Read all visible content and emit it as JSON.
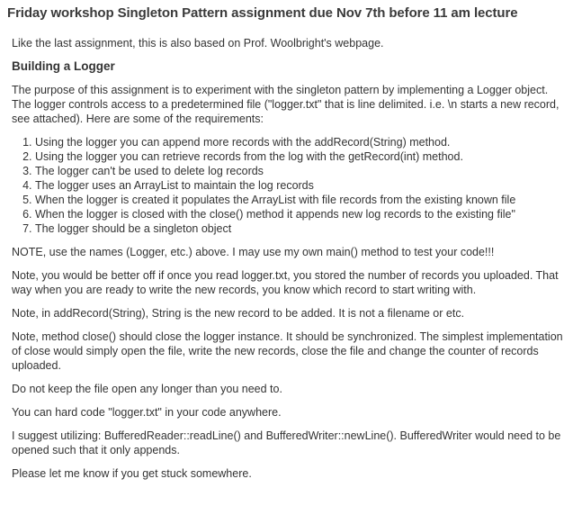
{
  "title": "Friday workshop Singleton Pattern assignment due Nov 7th before 11 am lecture",
  "intro": "Like the last assignment, this is also based on Prof. Woolbright's webpage.",
  "section_heading": "Building a Logger",
  "purpose": "The purpose of this assignment is to experiment with the singleton pattern by implementing a Logger object. The logger controls access to a predetermined file (\"logger.txt\" that is line delimited. i.e. \\n starts a new record, see attached). Here are some of the requirements:",
  "requirements": [
    "Using the logger you can append more records with the addRecord(String) method.",
    "Using the logger you can retrieve records from the log with the getRecord(int) method.",
    "The logger can't be used to delete log records",
    "The logger uses an ArrayList to maintain the log records",
    "When the logger is created it populates the ArrayList with file records from the existing known file",
    "When the logger is closed with the close() method it appends new log records to the existing file\"",
    "The logger should be a singleton object"
  ],
  "notes": [
    "NOTE, use the names (Logger, etc.) above. I may use my own main() method to test your code!!!",
    "Note, you would be better off if once you read logger.txt, you stored the number of records you uploaded. That way when you are ready to write the new records, you know which record to start writing with.",
    "Note, in addRecord(String), String is the new record to be added. It is not a filename or etc.",
    "Note, method close() should close the logger instance. It should be synchronized. The simplest implementation of close would simply open the file, write the new records, close the file and change the counter of records uploaded.",
    "Do not keep the file open any longer than you need to.",
    "You can hard code \"logger.txt\" in your code anywhere.",
    "I suggest utilizing: BufferedReader::readLine() and BufferedWriter::newLine(). BufferedWriter would need to be opened such that it only appends.",
    "Please let me know if you get stuck somewhere."
  ]
}
